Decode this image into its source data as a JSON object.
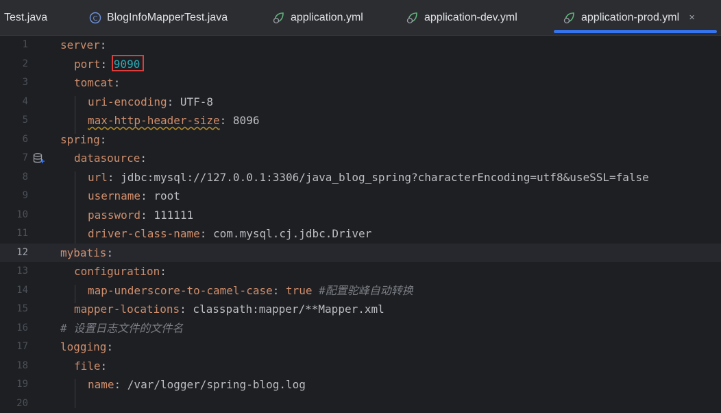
{
  "tabs": [
    {
      "label": "Test.java",
      "icon": "java-class-icon"
    },
    {
      "label": "BlogInfoMapperTest.java",
      "icon": "class-c-icon"
    },
    {
      "label": "application.yml",
      "icon": "spring-leaf-icon"
    },
    {
      "label": "application-dev.yml",
      "icon": "spring-leaf-icon"
    },
    {
      "label": "application-prod.yml",
      "icon": "spring-leaf-icon",
      "active": true
    }
  ],
  "close_glyph": "×",
  "lines": [
    {
      "n": "1",
      "key": "server",
      "sep": ":",
      "val": ""
    },
    {
      "n": "2",
      "key": "port",
      "sep": ": ",
      "val": "9090"
    },
    {
      "n": "3",
      "key": "tomcat",
      "sep": ":",
      "val": ""
    },
    {
      "n": "4",
      "key": "uri-encoding",
      "sep": ": ",
      "val": "UTF-8"
    },
    {
      "n": "5",
      "key": "max-http-header-size",
      "sep": ": ",
      "val": "8096"
    },
    {
      "n": "6",
      "key": "spring",
      "sep": ":",
      "val": ""
    },
    {
      "n": "7",
      "key": "datasource",
      "sep": ":",
      "val": ""
    },
    {
      "n": "8",
      "key": "url",
      "sep": ": ",
      "val": "jdbc:mysql://127.0.0.1:3306/java_blog_spring?characterEncoding=utf8&useSSL=false"
    },
    {
      "n": "9",
      "key": "username",
      "sep": ": ",
      "val": "root"
    },
    {
      "n": "10",
      "key": "password",
      "sep": ": ",
      "val": "111111"
    },
    {
      "n": "11",
      "key": "driver-class-name",
      "sep": ": ",
      "val": "com.mysql.cj.jdbc.Driver"
    },
    {
      "n": "12",
      "key": "mybatis",
      "sep": ":",
      "val": ""
    },
    {
      "n": "13",
      "key": "configuration",
      "sep": ":",
      "val": ""
    },
    {
      "n": "14",
      "key": "map-underscore-to-camel-case",
      "sep": ": ",
      "val": "true",
      "comment": "#配置驼峰自动转换"
    },
    {
      "n": "15",
      "key": "mapper-locations",
      "sep": ": ",
      "val": "classpath:mapper/**Mapper.xml"
    },
    {
      "n": "16",
      "comment_line": "# 设置日志文件的文件名"
    },
    {
      "n": "17",
      "key": "logging",
      "sep": ":",
      "val": ""
    },
    {
      "n": "18",
      "key": "file",
      "sep": ":",
      "val": ""
    },
    {
      "n": "19",
      "key": "name",
      "sep": ": ",
      "val": "/var/logger/spring-blog.log"
    },
    {
      "n": "20"
    }
  ],
  "colors": {
    "key": "#cf8e6d",
    "number": "#2aacb8",
    "comment": "#7a7e85",
    "text": "#bcbec4",
    "accent": "#3574f0",
    "highlight_box": "#e03c3c"
  }
}
